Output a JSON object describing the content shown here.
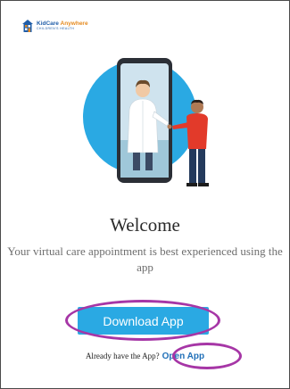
{
  "brand": {
    "name_primary": "KidCare",
    "name_secondary": "Anywhere",
    "tagline": "CHILDREN'S HEALTH",
    "colors": {
      "primary": "#1f5da8",
      "accent": "#e58a1f"
    }
  },
  "hero": {
    "illustration": "doctor-on-phone-video-call",
    "colors": {
      "circle": "#2aa9e3",
      "phone": "#2b2f36",
      "patient_shirt": "#e23a2a"
    }
  },
  "welcome": {
    "title": "Welcome",
    "subtitle": "Your virtual care appointment is best experienced using the app"
  },
  "actions": {
    "download_label": "Download App",
    "already_text": "Already have the App?",
    "open_label": "Open App",
    "colors": {
      "button": "#2aa9e3",
      "link": "#1f6fb8",
      "highlight_ring": "#a636a6"
    }
  }
}
